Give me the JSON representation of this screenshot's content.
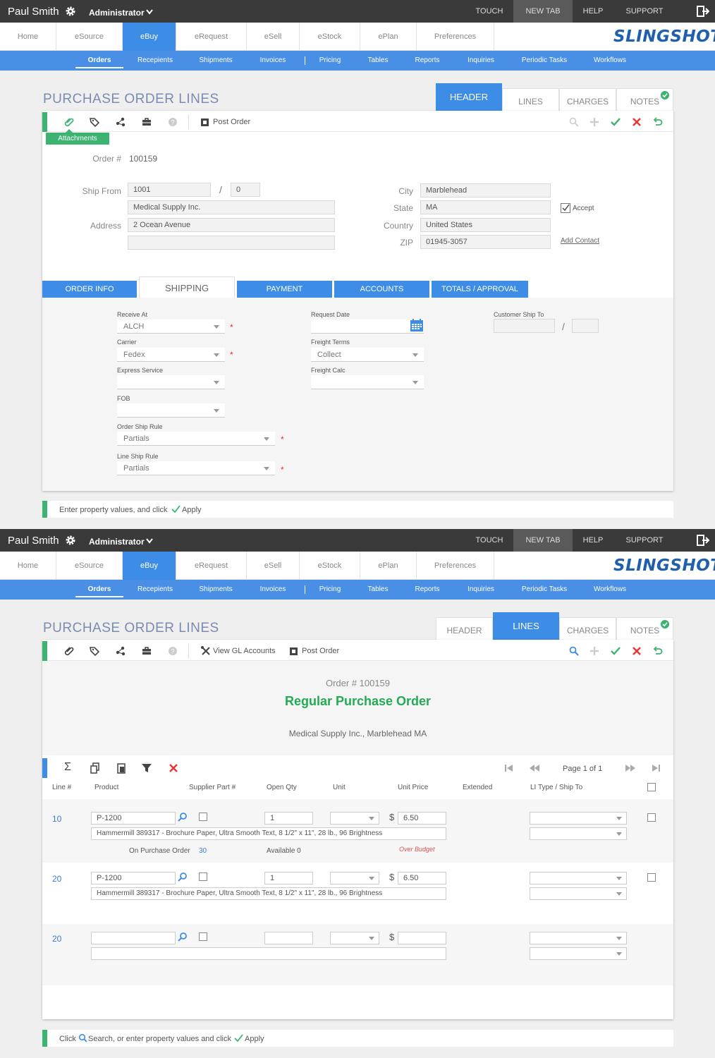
{
  "header": {
    "user": "Paul Smith",
    "role": "Administrator",
    "links": [
      "TOUCH",
      "NEW TAB",
      "HELP",
      "SUPPORT"
    ]
  },
  "mainnav": [
    "Home",
    "eSource",
    "eBuy",
    "eRequest",
    "eSell",
    "eStock",
    "ePlan",
    "Preferences"
  ],
  "logo": "SLINGSHOT",
  "subnav": [
    "Orders",
    "Recepients",
    "Shipments",
    "Invoices",
    "Pricing",
    "Tables",
    "Reports",
    "Inquiries",
    "Periodic Tasks",
    "Workflows"
  ],
  "page_title": "PURCHASE ORDER LINES",
  "right_tabs": [
    "HEADER",
    "LINES",
    "CHARGES",
    "NOTES"
  ],
  "toolbar": {
    "post_order": "Post Order",
    "view_gl": "View GL Accounts",
    "attachments_tooltip": "Attachments"
  },
  "order": {
    "label": "Order #",
    "number": "100159"
  },
  "ship_from": {
    "label": "Ship From",
    "code": "1001",
    "suffix": "0",
    "name": "Medical Supply Inc.",
    "address_label": "Address",
    "address1": "2 Ocean Avenue",
    "address2": ""
  },
  "location": {
    "city_label": "City",
    "city": "Marblehead",
    "state_label": "State",
    "state": "MA",
    "country_label": "Country",
    "country": "United States",
    "zip_label": "ZIP",
    "zip": "01945-3057",
    "accept_label": "Accept",
    "add_contact": "Add Contact"
  },
  "section_tabs": [
    "ORDER INFO",
    "SHIPPING",
    "PAYMENT",
    "ACCOUNTS",
    "TOTALS / APPROVAL"
  ],
  "shipping": {
    "receive_at_label": "Receive At",
    "receive_at": "ALCH",
    "carrier_label": "Carrier",
    "carrier": "Fedex",
    "express_label": "Express Service",
    "express": "",
    "fob_label": "FOB",
    "fob": "",
    "order_ship_rule_label": "Order Ship Rule",
    "order_ship_rule": "Partials",
    "line_ship_rule_label": "Line Ship Rule",
    "line_ship_rule": "Partials",
    "request_date_label": "Request Date",
    "request_date": "",
    "freight_terms_label": "Freight Terms",
    "freight_terms": "Collect",
    "freight_calc_label": "Freight Calc",
    "freight_calc": "",
    "customer_ship_to_label": "Customer Ship To"
  },
  "status1": {
    "text": "Enter property values, and click",
    "apply": "Apply"
  },
  "lines_view": {
    "order_line": "Order #  100159",
    "order_type": "Regular Purchase Order",
    "supplier": "Medical Supply Inc., Marblehead MA",
    "page": "Page 1 of 1",
    "columns": [
      "Line #",
      "Product",
      "Supplier Part #",
      "Open Qty",
      "Unit",
      "Unit Price",
      "Extended",
      "LI Type / Ship To"
    ],
    "rows": [
      {
        "line": "10",
        "product": "P-1200",
        "qty": "1",
        "price": "6.50",
        "desc": "Hammermill 389317 - Brochure Paper, Ultra Smooth Text, 8 1/2\" x 11\", 28 lb., 96 Brightness",
        "on_po_label": "On Purchase Order",
        "on_po": "30",
        "available": "Available  0",
        "budget": "Over Budget"
      },
      {
        "line": "20",
        "product": "P-1200",
        "qty": "1",
        "price": "6.50",
        "desc": "Hammermill 389317 - Brochure Paper, Ultra Smooth Text, 8 1/2\" x 11\", 28 lb., 96 Brightness"
      },
      {
        "line": "20",
        "product": "",
        "qty": "",
        "price": "",
        "desc": ""
      }
    ],
    "currency": "$"
  },
  "status2": {
    "click": "Click",
    "search": "Search, or enter property values and click",
    "apply": "Apply"
  }
}
